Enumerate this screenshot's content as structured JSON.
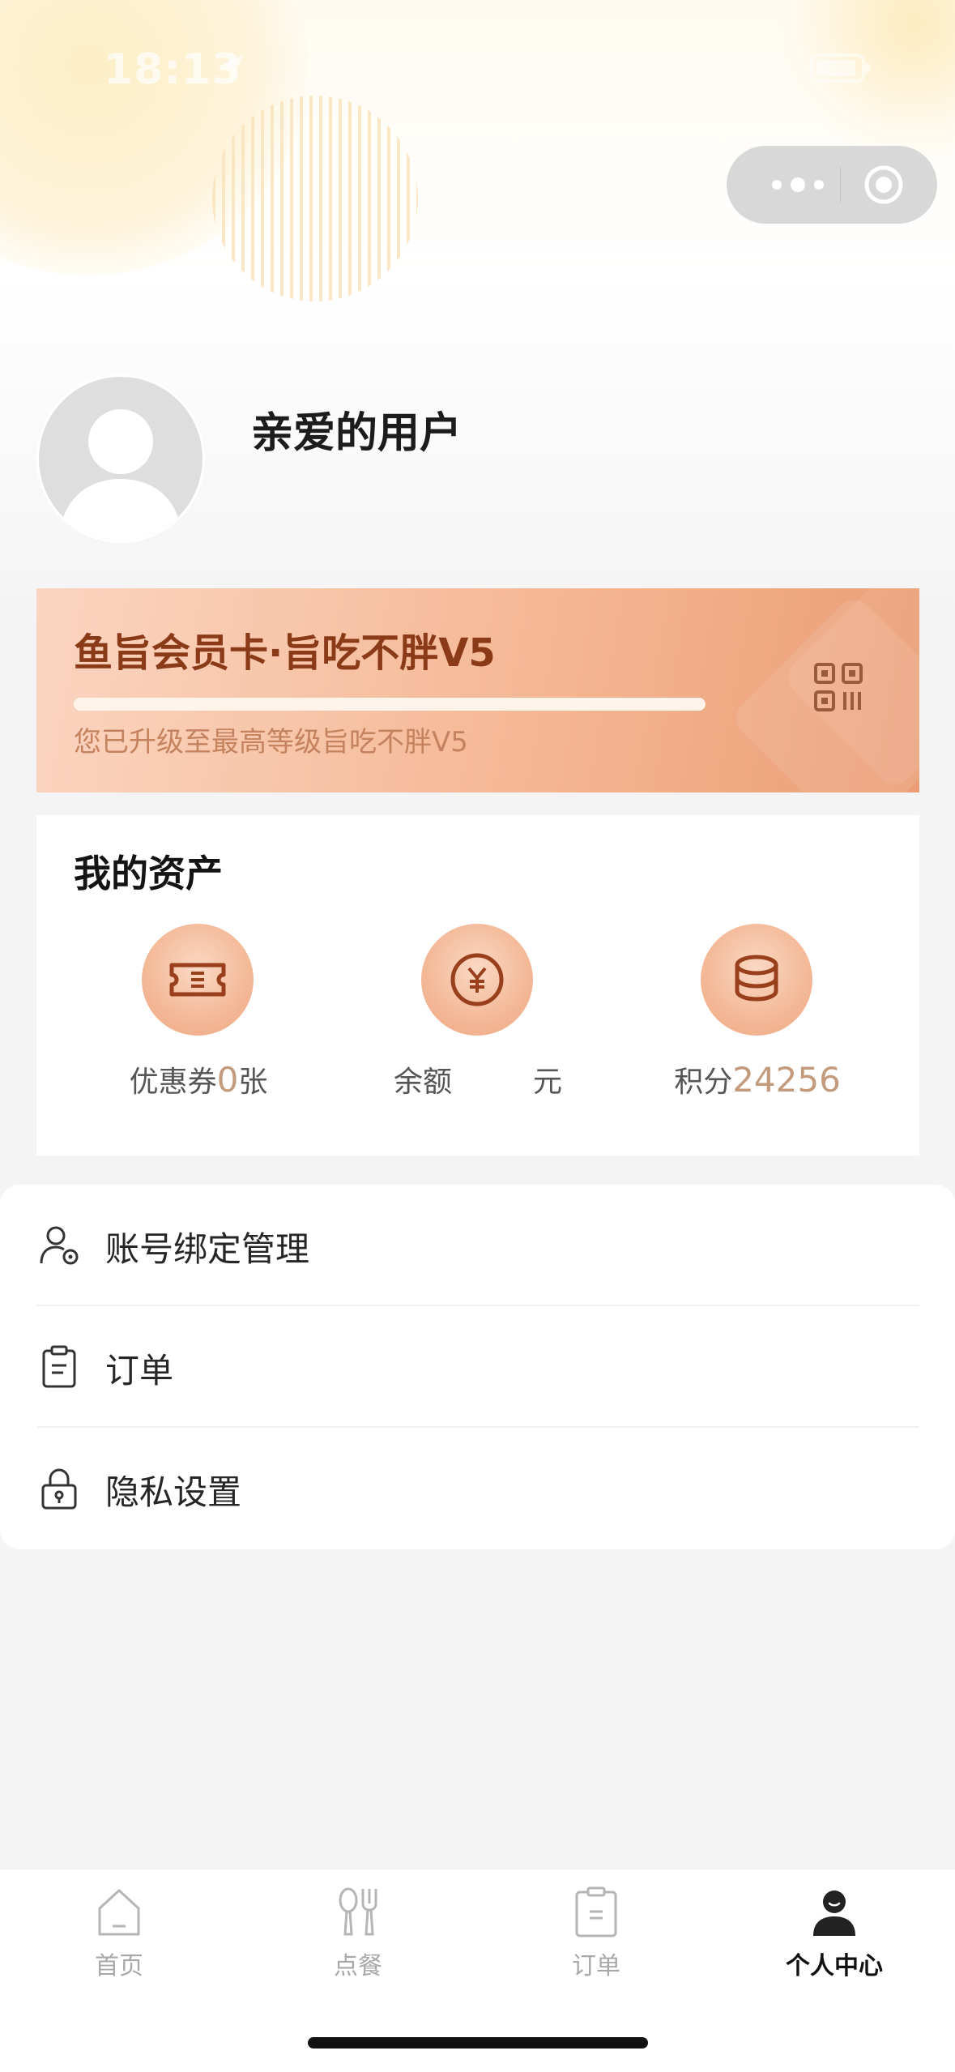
{
  "status_bar": {
    "time": "18:13"
  },
  "profile": {
    "name": "亲爱的用户"
  },
  "member_card": {
    "title": "鱼旨会员卡·旨吃不胖V5",
    "note": "您已升级至最高等级旨吃不胖V5",
    "progress": 1.0
  },
  "assets": {
    "title": "我的资产",
    "coupon": {
      "prefix": "优惠券",
      "value": "0",
      "suffix": "张",
      "icon": "ticket-icon"
    },
    "balance": {
      "prefix": "余额",
      "value": "",
      "suffix": "元",
      "icon": "yen-icon"
    },
    "points": {
      "prefix": "积分",
      "value": "24256",
      "icon": "coins-icon"
    }
  },
  "menu": {
    "items": [
      {
        "label": "账号绑定管理",
        "icon": "user-gear-icon"
      },
      {
        "label": "订单",
        "icon": "clipboard-icon"
      },
      {
        "label": "隐私设置",
        "icon": "lock-icon"
      }
    ]
  },
  "tabbar": {
    "tabs": [
      {
        "label": "首页",
        "icon": "home-icon",
        "active": false
      },
      {
        "label": "点餐",
        "icon": "utensils-icon",
        "active": false
      },
      {
        "label": "订单",
        "icon": "order-icon",
        "active": false
      },
      {
        "label": "个人中心",
        "icon": "person-icon",
        "active": true
      }
    ]
  },
  "colors": {
    "accent": "#8b3a18",
    "card_gradient_start": "#fbd5c1",
    "card_gradient_end": "#ea9d74",
    "asset_value": "#c49a7c",
    "tab_inactive": "#a8a8a8",
    "tab_active": "#111111"
  }
}
